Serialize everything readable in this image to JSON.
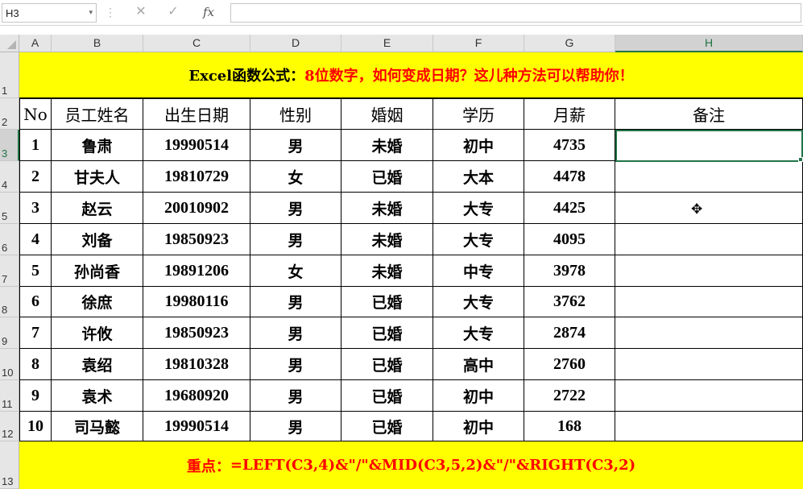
{
  "formula_bar": {
    "name_box": "H3",
    "name_box_arrow": "▾",
    "separator": "⋮",
    "cancel_icon": "✕",
    "enter_icon": "✓",
    "fx_label": "fx",
    "formula": ""
  },
  "columns": [
    "A",
    "B",
    "C",
    "D",
    "E",
    "F",
    "G",
    "H"
  ],
  "rows": [
    "1",
    "2",
    "3",
    "4",
    "5",
    "6",
    "7",
    "8",
    "9",
    "10",
    "11",
    "12",
    "13"
  ],
  "title": {
    "part1": "Excel函数公式：",
    "part2": "8位数字，如何变成日期？这儿种方法可以帮助你！"
  },
  "headers": [
    "No",
    "员工姓名",
    "出生日期",
    "性别",
    "婚姻",
    "学历",
    "月薪",
    "备注"
  ],
  "table": [
    [
      "1",
      "鲁肃",
      "19990514",
      "男",
      "未婚",
      "初中",
      "4735",
      ""
    ],
    [
      "2",
      "甘夫人",
      "19810729",
      "女",
      "已婚",
      "大本",
      "4478",
      ""
    ],
    [
      "3",
      "赵云",
      "20010902",
      "男",
      "未婚",
      "大专",
      "4425",
      ""
    ],
    [
      "4",
      "刘备",
      "19850923",
      "男",
      "未婚",
      "大专",
      "4095",
      ""
    ],
    [
      "5",
      "孙尚香",
      "19891206",
      "女",
      "未婚",
      "中专",
      "3978",
      ""
    ],
    [
      "6",
      "徐庶",
      "19980116",
      "男",
      "已婚",
      "大专",
      "3762",
      ""
    ],
    [
      "7",
      "许攸",
      "19850923",
      "男",
      "已婚",
      "大专",
      "2874",
      ""
    ],
    [
      "8",
      "袁绍",
      "19810328",
      "男",
      "已婚",
      "高中",
      "2760",
      ""
    ],
    [
      "9",
      "袁术",
      "19680920",
      "男",
      "已婚",
      "初中",
      "2722",
      ""
    ],
    [
      "10",
      "司马懿",
      "19990514",
      "男",
      "已婚",
      "初中",
      "168",
      ""
    ]
  ],
  "footer": {
    "label": "重点：",
    "formula": "=LEFT(C3,4)&\"/\"&MID(C3,5,2)&\"/\"&RIGHT(C3,2)"
  },
  "selected_cell": "H3",
  "colors": {
    "banner_bg": "#ffff00",
    "accent_red": "#ff0000",
    "selection_green": "#217346"
  }
}
